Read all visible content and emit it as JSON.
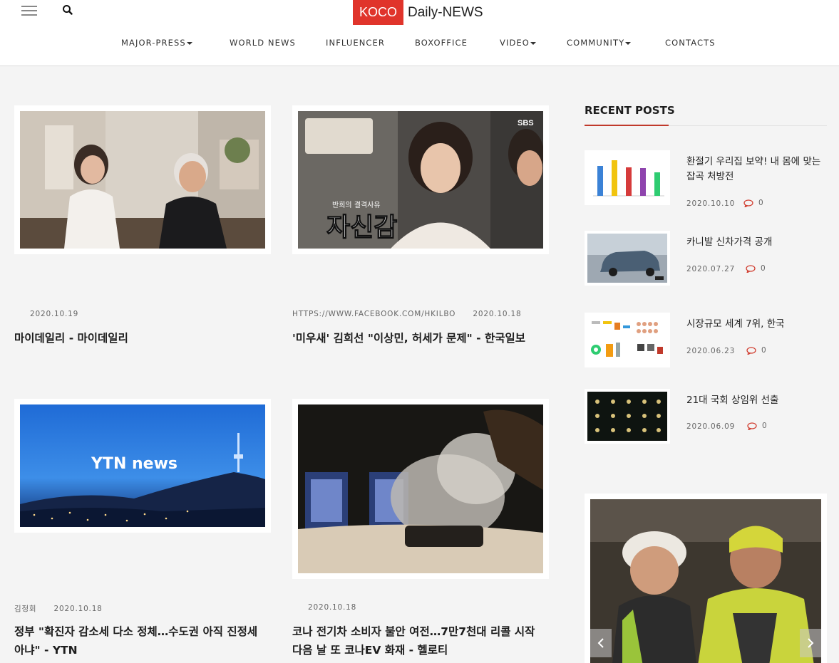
{
  "header": {
    "logo_badge": "KOCO",
    "logo_text": "Daily-NEWS",
    "nav": [
      {
        "label": "MAJOR-PRESS",
        "dropdown": true
      },
      {
        "label": "WORLD NEWS",
        "dropdown": false
      },
      {
        "label": "INFLUENCER",
        "dropdown": false
      },
      {
        "label": "BOXOFFICE",
        "dropdown": false
      },
      {
        "label": "VIDEO",
        "dropdown": true
      },
      {
        "label": "COMMUNITY",
        "dropdown": true
      },
      {
        "label": "CONTACTS",
        "dropdown": false
      }
    ]
  },
  "posts": [
    {
      "source": "",
      "date": "2020.10.19",
      "title": "마이데일리 - 마이데일리",
      "image_text": ""
    },
    {
      "source": "HTTPS://WWW.FACEBOOK.COM/HKILBO",
      "date": "2020.10.18",
      "title": "'미우새' 김희선 \"이상민, 허세가 문제\" - 한국일보",
      "image_text": "자신감",
      "image_caption": "반희의 결격사유",
      "image_corner": "SBS"
    },
    {
      "source": "김정회",
      "date": "2020.10.18",
      "title": "정부 \"확진자 감소세 다소 정체…수도권 아직 진정세 아냐\" - YTN",
      "image_text": "YTN news"
    },
    {
      "source": "",
      "date": "2020.10.18",
      "title": "코나 전기차 소비자 불안 여전…7만7천대 리콜 시작 다음 날 또 코나EV 화재 - 헬로티",
      "image_text": ""
    }
  ],
  "sidebar": {
    "heading": "RECENT POSTS",
    "recent_posts": [
      {
        "title": "환절기 우리집 보약! 내 몸에 맞는 잡곡 처방전",
        "date": "2020.10.10",
        "comments": "0"
      },
      {
        "title": "카니발 신차가격 공개",
        "date": "2020.07.27",
        "comments": "0"
      },
      {
        "title": "시장규모 세계 7위, 한국",
        "date": "2020.06.23",
        "comments": "0"
      },
      {
        "title": "21대 국회 상임위 선출",
        "date": "2020.06.09",
        "comments": "0"
      }
    ]
  },
  "colors": {
    "accent": "#e0342b",
    "heading_rule": "#c0392b",
    "comment_icon": "#d0392b"
  }
}
